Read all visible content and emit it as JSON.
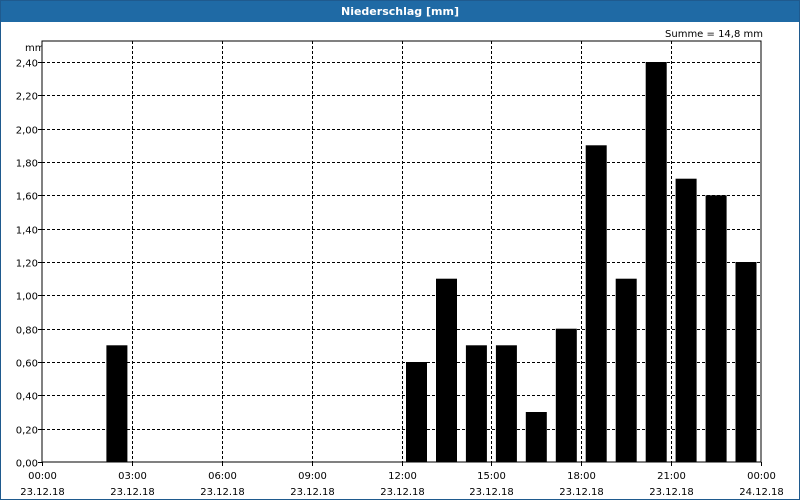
{
  "window": {
    "title": "Niederschlag [mm]"
  },
  "summary": "Summe = 14,8 mm",
  "chart_data": {
    "type": "bar",
    "title": "Niederschlag [mm]",
    "ylabel": "mm",
    "xlabel": "",
    "ylim": [
      0,
      2.4
    ],
    "y_ticks": [
      "0,00",
      "0,20",
      "0,40",
      "0,60",
      "0,80",
      "1,00",
      "1,20",
      "1,40",
      "1,60",
      "1,80",
      "2,00",
      "2,20",
      "2,40"
    ],
    "x_tick_labels": [
      {
        "time": "00:00",
        "date": "23.12.18"
      },
      {
        "time": "03:00",
        "date": "23.12.18"
      },
      {
        "time": "06:00",
        "date": "23.12.18"
      },
      {
        "time": "09:00",
        "date": "23.12.18"
      },
      {
        "time": "12:00",
        "date": "23.12.18"
      },
      {
        "time": "15:00",
        "date": "23.12.18"
      },
      {
        "time": "18:00",
        "date": "23.12.18"
      },
      {
        "time": "21:00",
        "date": "23.12.18"
      },
      {
        "time": "00:00",
        "date": "24.12.18"
      }
    ],
    "x_start": "2018-12-23T00:00",
    "x_end": "2018-12-24T00:00",
    "bar_color": "#000000",
    "grid": true,
    "bars": [
      {
        "time": "2018-12-23T03:00",
        "value": 0.7
      },
      {
        "time": "2018-12-23T13:00",
        "value": 0.6
      },
      {
        "time": "2018-12-23T14:00",
        "value": 1.1
      },
      {
        "time": "2018-12-23T15:00",
        "value": 0.7
      },
      {
        "time": "2018-12-23T16:00",
        "value": 0.7
      },
      {
        "time": "2018-12-23T17:00",
        "value": 0.3
      },
      {
        "time": "2018-12-23T18:00",
        "value": 0.8
      },
      {
        "time": "2018-12-23T19:00",
        "value": 1.9
      },
      {
        "time": "2018-12-23T20:00",
        "value": 1.1
      },
      {
        "time": "2018-12-23T21:00",
        "value": 2.4
      },
      {
        "time": "2018-12-23T22:00",
        "value": 1.7
      },
      {
        "time": "2018-12-23T23:00",
        "value": 1.6
      },
      {
        "time": "2018-12-24T00:00",
        "value": 1.2
      }
    ]
  }
}
